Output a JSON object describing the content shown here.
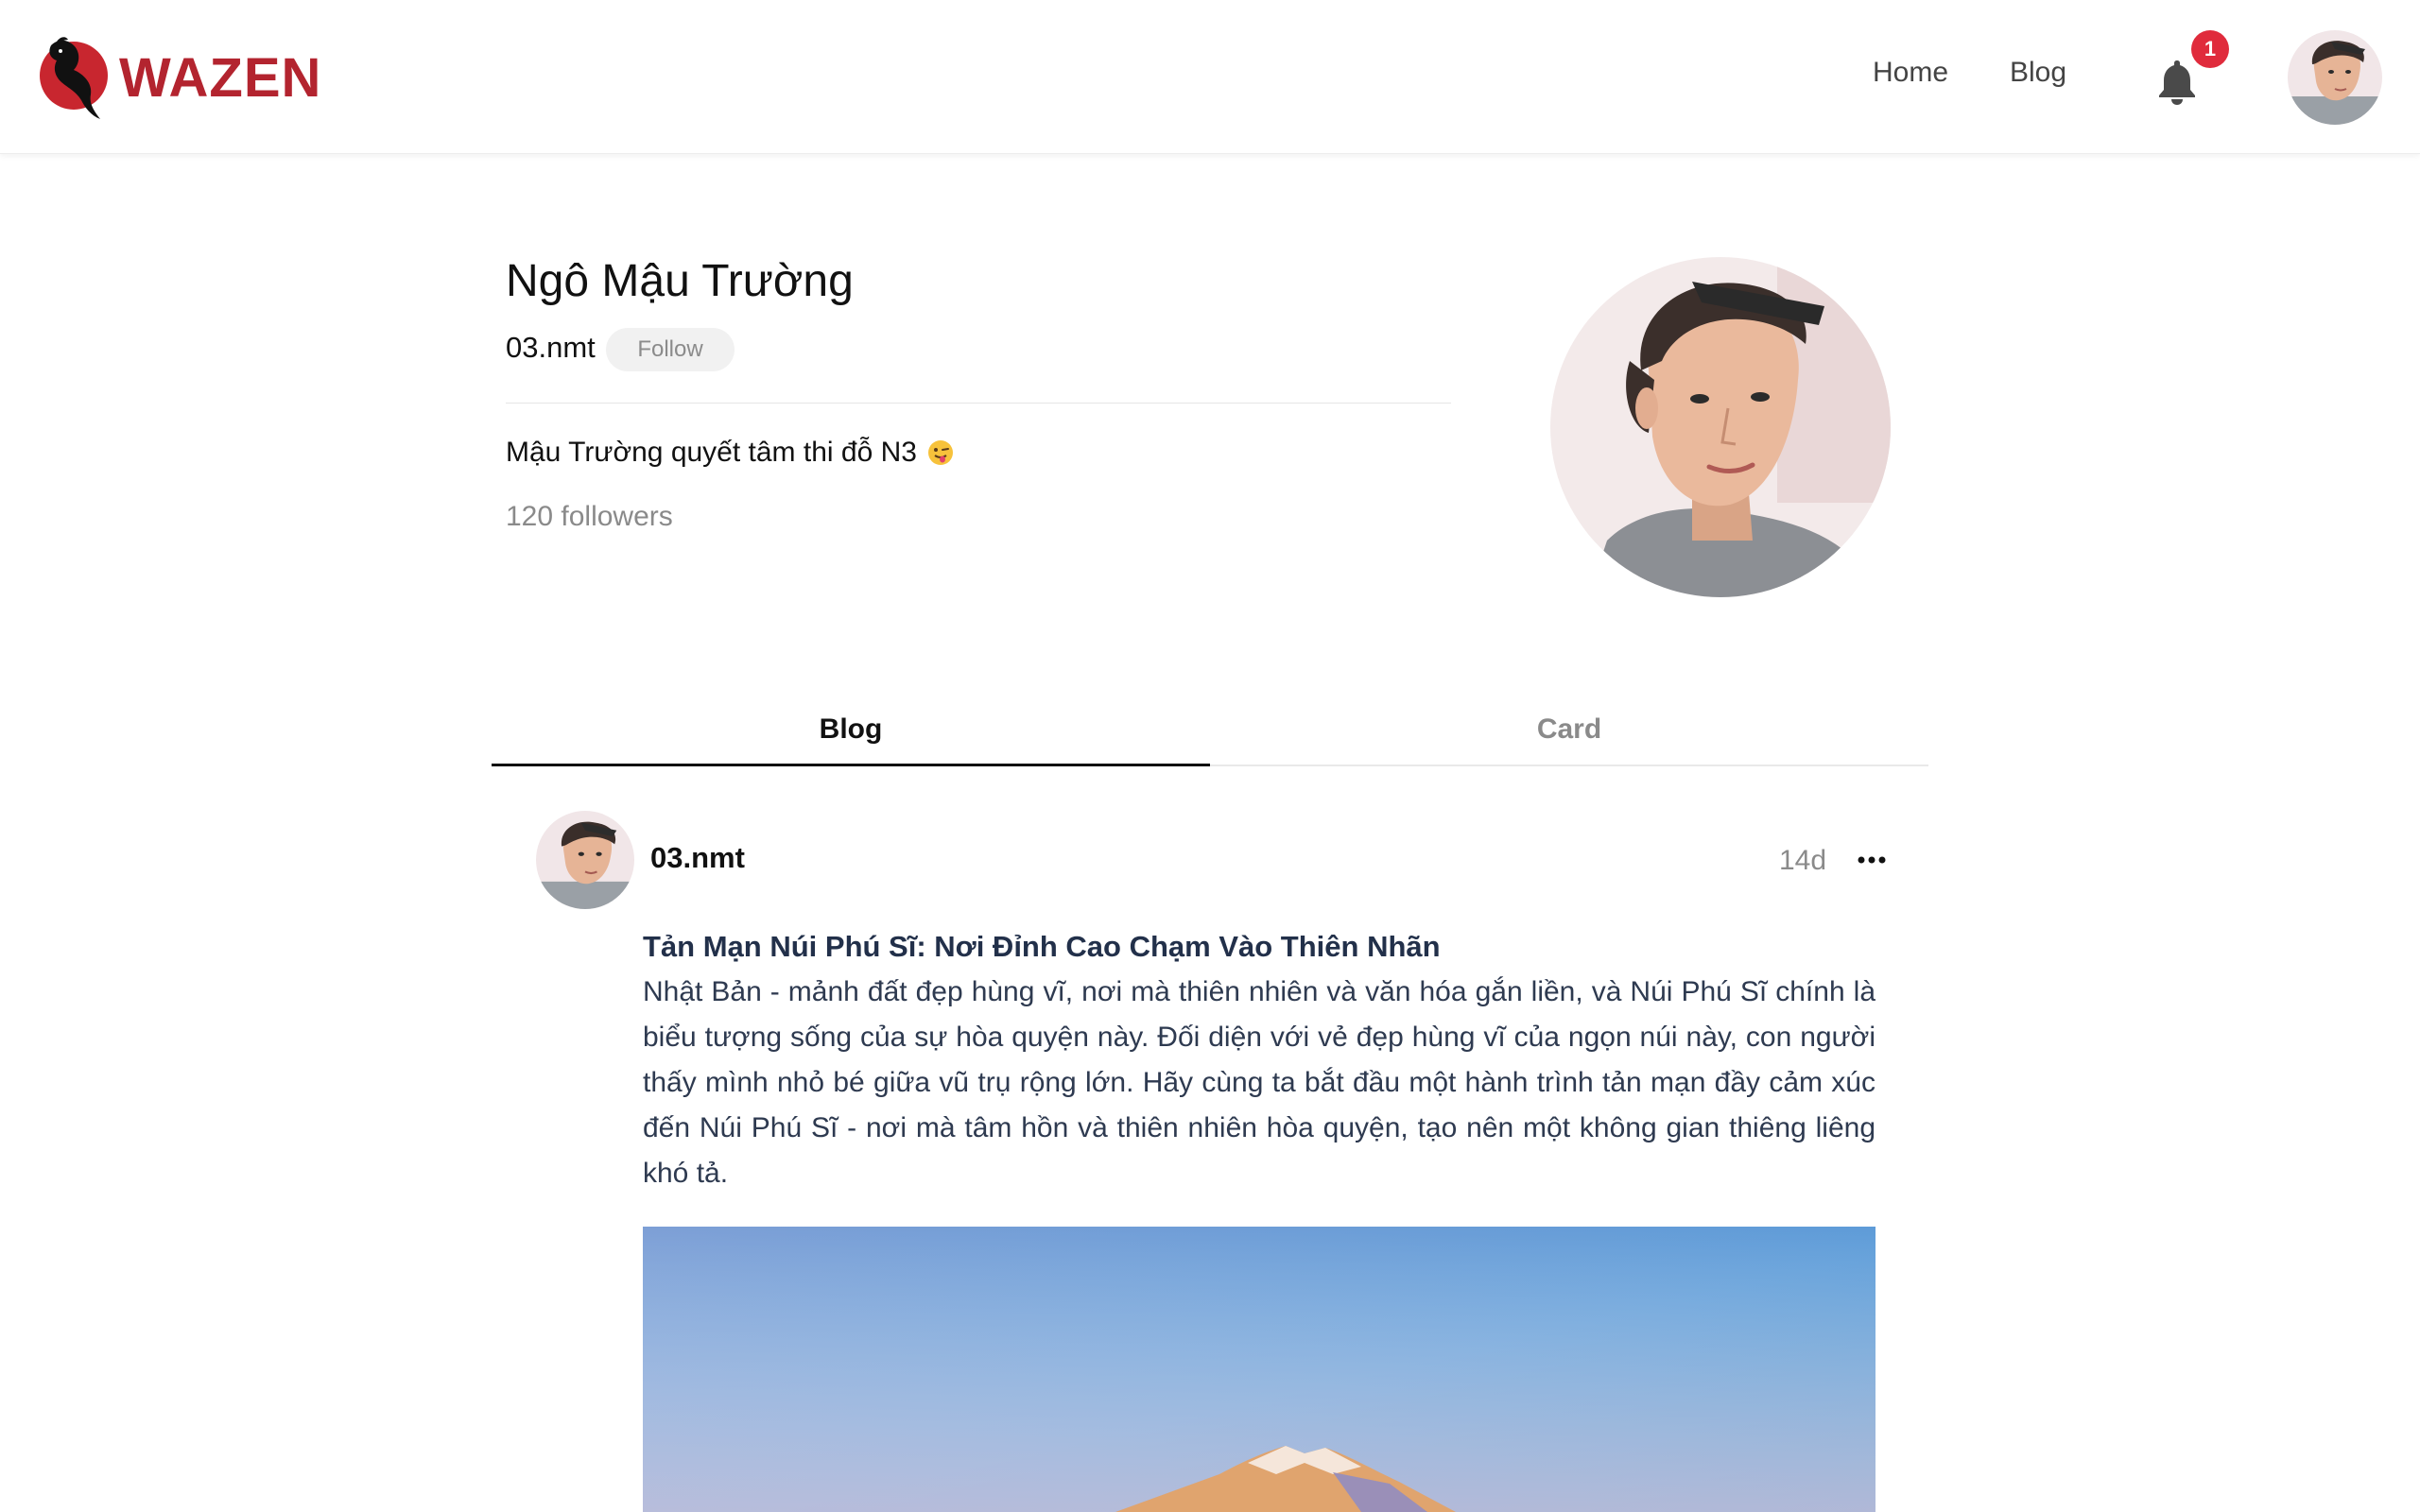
{
  "brand": {
    "name": "WAZEN",
    "color": "#b3242f"
  },
  "nav": {
    "home_label": "Home",
    "blog_label": "Blog",
    "notification_count": "1"
  },
  "profile": {
    "name": "Ngô Mậu Trường",
    "handle": "03.nmt",
    "follow_label": "Follow",
    "bio": "Mậu Trường quyết tâm thi đỗ N3",
    "bio_emoji_icon": "winking-tongue-emoji-icon",
    "followers": "120 followers"
  },
  "tabs": [
    {
      "label": "Blog",
      "active": true
    },
    {
      "label": "Card",
      "active": false
    }
  ],
  "post": {
    "author": "03.nmt",
    "time": "14d",
    "more_icon": "more-horizontal-icon",
    "title": "Tản Mạn Núi Phú Sĩ: Nơi Đỉnh Cao Chạm Vào Thiên Nhãn",
    "body": "Nhật Bản - mảnh đất đẹp hùng vĩ, nơi mà thiên nhiên và văn hóa gắn liền, và Núi Phú Sĩ chính là biểu tượng sống của sự hòa quyện này. Đối diện với vẻ đẹp hùng vĩ của ngọn núi này, con người thấy mình nhỏ bé giữa vũ trụ rộng lớn. Hãy cùng ta bắt đầu một hành trình tản mạn đầy cảm xúc đến Núi Phú Sĩ - nơi mà tâm hồn và thiên nhiên hòa quyện, tạo nên một không gian thiêng liêng khó tả."
  },
  "colors": {
    "badge": "#e02b3c",
    "muted_text": "#8a8a8a",
    "post_text": "#2e3a50"
  }
}
